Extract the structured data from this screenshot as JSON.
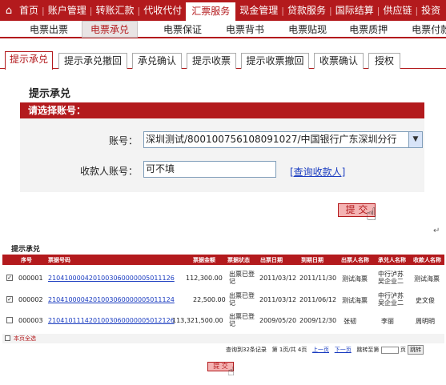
{
  "topnav": {
    "items": [
      "首页",
      "账户管理",
      "转账汇款",
      "代收代付",
      "汇票服务",
      "现金管理",
      "贷款服务",
      "国际结算",
      "供应链",
      "投资"
    ],
    "active": 4
  },
  "subnav": {
    "items": [
      "电票出票",
      "电票承兑",
      "电票保证",
      "电票背书",
      "电票贴现",
      "电票质押",
      "电票付款"
    ],
    "active": 1
  },
  "tabs": {
    "items": [
      "提示承兑",
      "提示承兑撤回",
      "承兑确认",
      "提示收票",
      "提示收票撤回",
      "收票确认",
      "授权"
    ],
    "active": 0
  },
  "form": {
    "title": "提示承兑",
    "section": "请选择账号：",
    "account_label": "账号：",
    "account_value": "深圳测试/800100756108091027/中国银行广东深圳分行",
    "payee_label": "收款人账号：",
    "payee_value": "可不填",
    "query_link": "[查询收款人]",
    "submit": "提 交"
  },
  "table": {
    "title": "提示承兑",
    "headers": [
      "序号",
      "票据号码",
      "票据金额",
      "票据状态",
      "出票日期",
      "到期日期",
      "出票人名称",
      "承兑人名称",
      "收款人名称"
    ],
    "rows": [
      {
        "checked": true,
        "seq": "000001",
        "no": "2104100004201003060000005011126",
        "amount": "112,300.00",
        "status": "出票已登记",
        "issue": "2011/03/12",
        "due": "2011/11/30",
        "drawer": "测试海票",
        "acceptor": "中行泸苏吴企业二",
        "payee": "测试海票"
      },
      {
        "checked": true,
        "seq": "000002",
        "no": "2104100004201003060000005011124",
        "amount": "22,500.00",
        "status": "出票已登记",
        "issue": "2011/03/12",
        "due": "2011/06/12",
        "drawer": "测试海票",
        "acceptor": "中行泸苏吴企业二",
        "payee": "史文俊"
      },
      {
        "checked": false,
        "seq": "000003",
        "no": "2104101114201003060000005012126",
        "amount": "113,321,500.00",
        "status": "出票已登记",
        "issue": "2009/05/20",
        "due": "2009/12/30",
        "drawer": "张韧",
        "acceptor": "李丽",
        "payee": "周明明"
      }
    ],
    "select_all": "本页全选",
    "pager": {
      "summary": "查询到32条记录",
      "page": "第 1页/共 4页",
      "prev": "上一页",
      "next": "下一页",
      "jump": "跳转至第",
      "unit": "页",
      "go": "跳转"
    },
    "submit": "提 交"
  },
  "colors": {
    "brand": "#b31a1d",
    "link": "#1a3cc0"
  }
}
